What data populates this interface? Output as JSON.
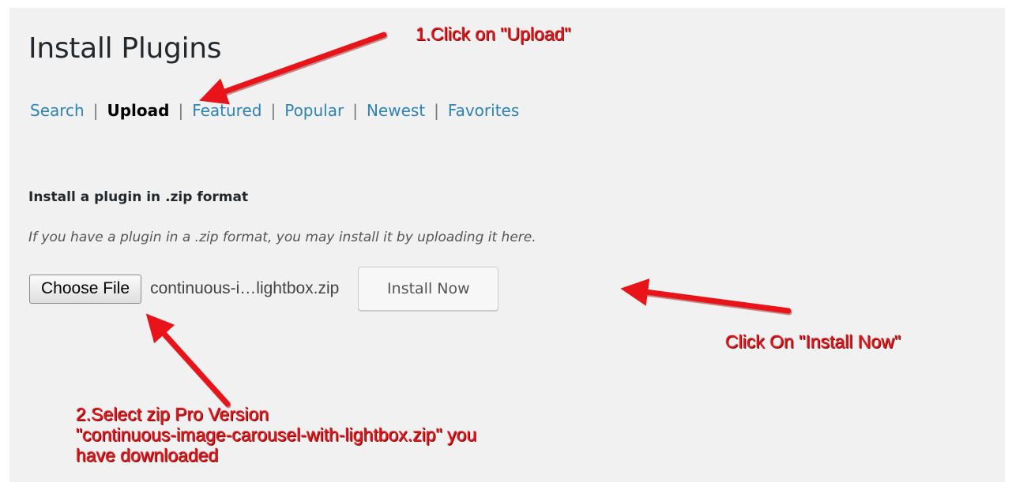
{
  "page": {
    "title": "Install Plugins"
  },
  "filters": [
    {
      "label": "Search",
      "current": false
    },
    {
      "label": "Upload",
      "current": true
    },
    {
      "label": "Featured",
      "current": false
    },
    {
      "label": "Popular",
      "current": false
    },
    {
      "label": "Newest",
      "current": false
    },
    {
      "label": "Favorites",
      "current": false
    }
  ],
  "separator": "|",
  "upload": {
    "heading": "Install a plugin in .zip format",
    "description": "If you have a plugin in a .zip format, you may install it by uploading it here.",
    "choose_file_label": "Choose File",
    "file_name": "continuous-i…lightbox.zip",
    "install_label": "Install Now"
  },
  "annotations": {
    "step1": "1.Click on \"Upload\"",
    "step2_line1": "2.Select zip Pro Version",
    "step2_line2": "\"continuous-image-carousel-with-lightbox.zip\" you",
    "step2_line3": "have downloaded",
    "step3": "Click On \"Install Now\""
  },
  "colors": {
    "background": "#f1f1f1",
    "link": "#2e83b3",
    "annotation": "#e8141a"
  }
}
